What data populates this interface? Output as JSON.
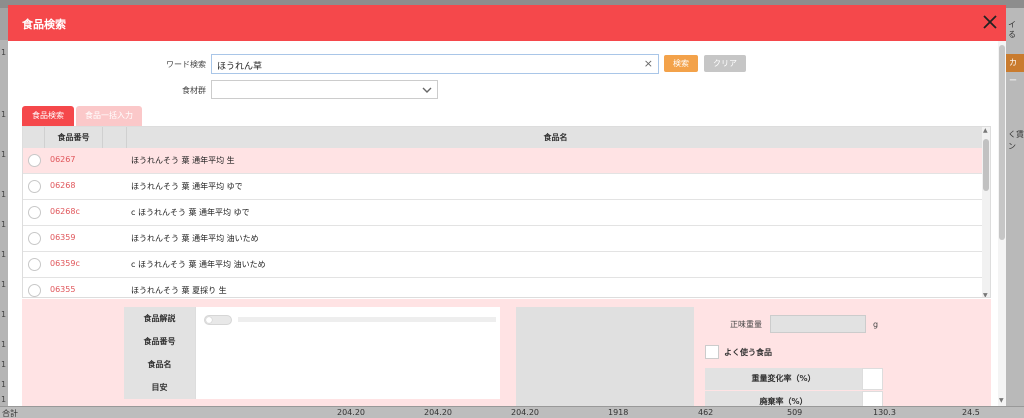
{
  "background": {
    "left_numbers": [
      "1",
      "1",
      "1",
      "1",
      "1",
      "1",
      "1",
      "1",
      "1",
      "1",
      "1",
      "1"
    ],
    "right_texts": [
      "イ",
      "る",
      "く賃",
      "ン"
    ],
    "orange_label": "カー",
    "footer": {
      "label": "合計",
      "values": [
        "204.20",
        "204.20",
        "204.20",
        "1918",
        "462",
        "509",
        "130.3",
        "24.5"
      ]
    }
  },
  "modal": {
    "title": "食品検索",
    "search": {
      "word_label": "ワード検索",
      "word_value": "ほうれん草",
      "clear_x": "×",
      "search_button": "検索",
      "clear_button": "クリア",
      "group_label": "食材群",
      "group_value": ""
    },
    "tabs": [
      "食品検索",
      "食品一括入力"
    ],
    "table": {
      "headers": [
        "食品番号",
        "食品名"
      ],
      "rows": [
        {
          "code": "06267",
          "name": "ほうれんそう 葉 通年平均 生"
        },
        {
          "code": "06268",
          "name": "ほうれんそう 葉 通年平均 ゆで"
        },
        {
          "code": "06268c",
          "name": "c ほうれんそう 葉 通年平均 ゆで"
        },
        {
          "code": "06359",
          "name": "ほうれんそう 葉 通年平均 油いため"
        },
        {
          "code": "06359c",
          "name": "c ほうれんそう 葉 通年平均 油いため"
        },
        {
          "code": "06355",
          "name": "ほうれんそう 葉 夏採り 生"
        }
      ]
    },
    "detail": {
      "fields": [
        "食品解説",
        "食品番号",
        "食品名",
        "目安"
      ],
      "net_weight_label": "正味重量",
      "net_weight_value": "",
      "unit": "g",
      "favorite_label": "よく使う食品",
      "rates": [
        "重量変化率（%）",
        "廃棄率（%）"
      ]
    }
  },
  "colors": {
    "header_red": "#f5484b",
    "selected_row": "#ffe3e4",
    "search_orange": "#f3a24a",
    "clear_gray": "#c6c6c6"
  }
}
